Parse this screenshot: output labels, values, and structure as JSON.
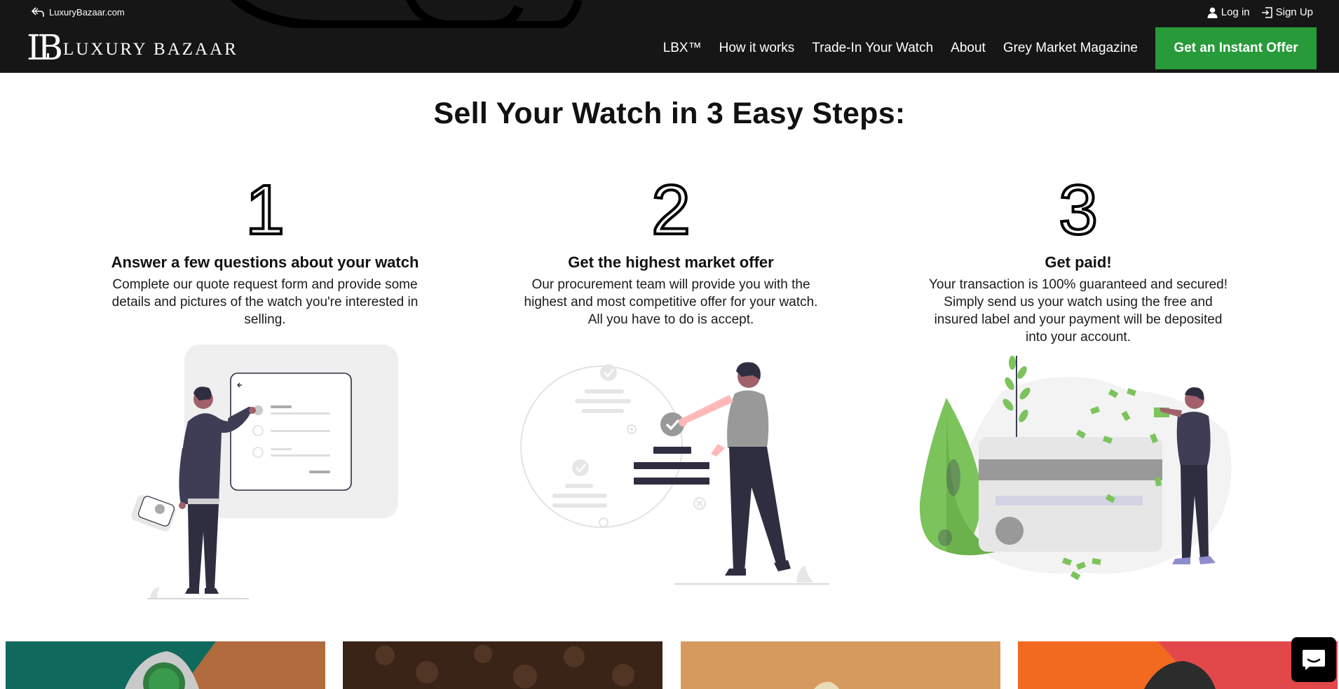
{
  "topbar": {
    "back_link": "LuxuryBazaar.com",
    "login": "Log in",
    "signup": "Sign Up"
  },
  "logo": {
    "mark": "LB",
    "text": "LUXURY BAZAAR"
  },
  "nav": {
    "items": [
      "LBX™",
      "How it works",
      "Trade-In Your Watch",
      "About",
      "Grey Market Magazine"
    ],
    "cta": "Get an Instant Offer"
  },
  "main": {
    "title": "Sell Your Watch in 3 Easy Steps:",
    "steps": [
      {
        "number": "1",
        "title": "Answer a few questions about your watch",
        "text": "Complete our quote request form and provide some details and pictures of the watch you're interested in selling."
      },
      {
        "number": "2",
        "title": "Get the highest market offer",
        "text": "Our procurement team will provide you with the highest and most competitive offer for your watch. All you have to do is accept."
      },
      {
        "number": "3",
        "title": "Get paid!",
        "text": "Your transaction is 100% guaranteed and secured! Simply send us your watch using the free and insured label and your payment will be deposited into your account."
      }
    ]
  },
  "colors": {
    "header_bg": "#161616",
    "cta_green": "#279a3a",
    "illustration_green": "#7cc35c",
    "illustration_dark": "#2f2e41"
  },
  "icons": [
    "back-arrow-icon",
    "user-icon",
    "sign-in-icon",
    "chat-icon"
  ]
}
